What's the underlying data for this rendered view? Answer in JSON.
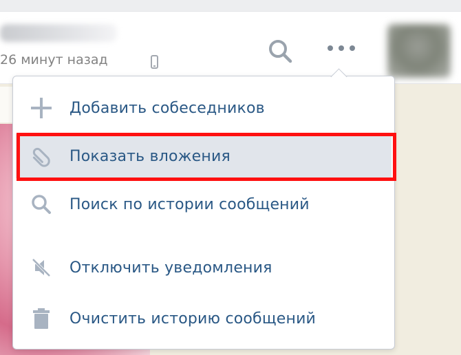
{
  "header": {
    "last_seen": "26 минут назад",
    "icons": {
      "search": "search-icon",
      "more": "more-dots-icon",
      "device": "phone-icon"
    }
  },
  "menu": {
    "items": [
      {
        "label": "Добавить собеседников",
        "icon": "plus-icon",
        "highlighted": false
      },
      {
        "label": "Показать вложения",
        "icon": "paperclip-icon",
        "highlighted": true
      },
      {
        "label": "Поиск по истории сообщений",
        "icon": "search-icon",
        "highlighted": false
      },
      {
        "label": "Отключить уведомления",
        "icon": "mute-bell-icon",
        "highlighted": false
      },
      {
        "label": "Очистить историю сообщений",
        "icon": "trash-icon",
        "highlighted": false
      }
    ]
  },
  "colors": {
    "link": "#2a5885",
    "icon": "#a8b3c1",
    "highlight_row": "#e1e5eb",
    "annotation": "#ff1010",
    "chat_background": "#f1ede0"
  }
}
